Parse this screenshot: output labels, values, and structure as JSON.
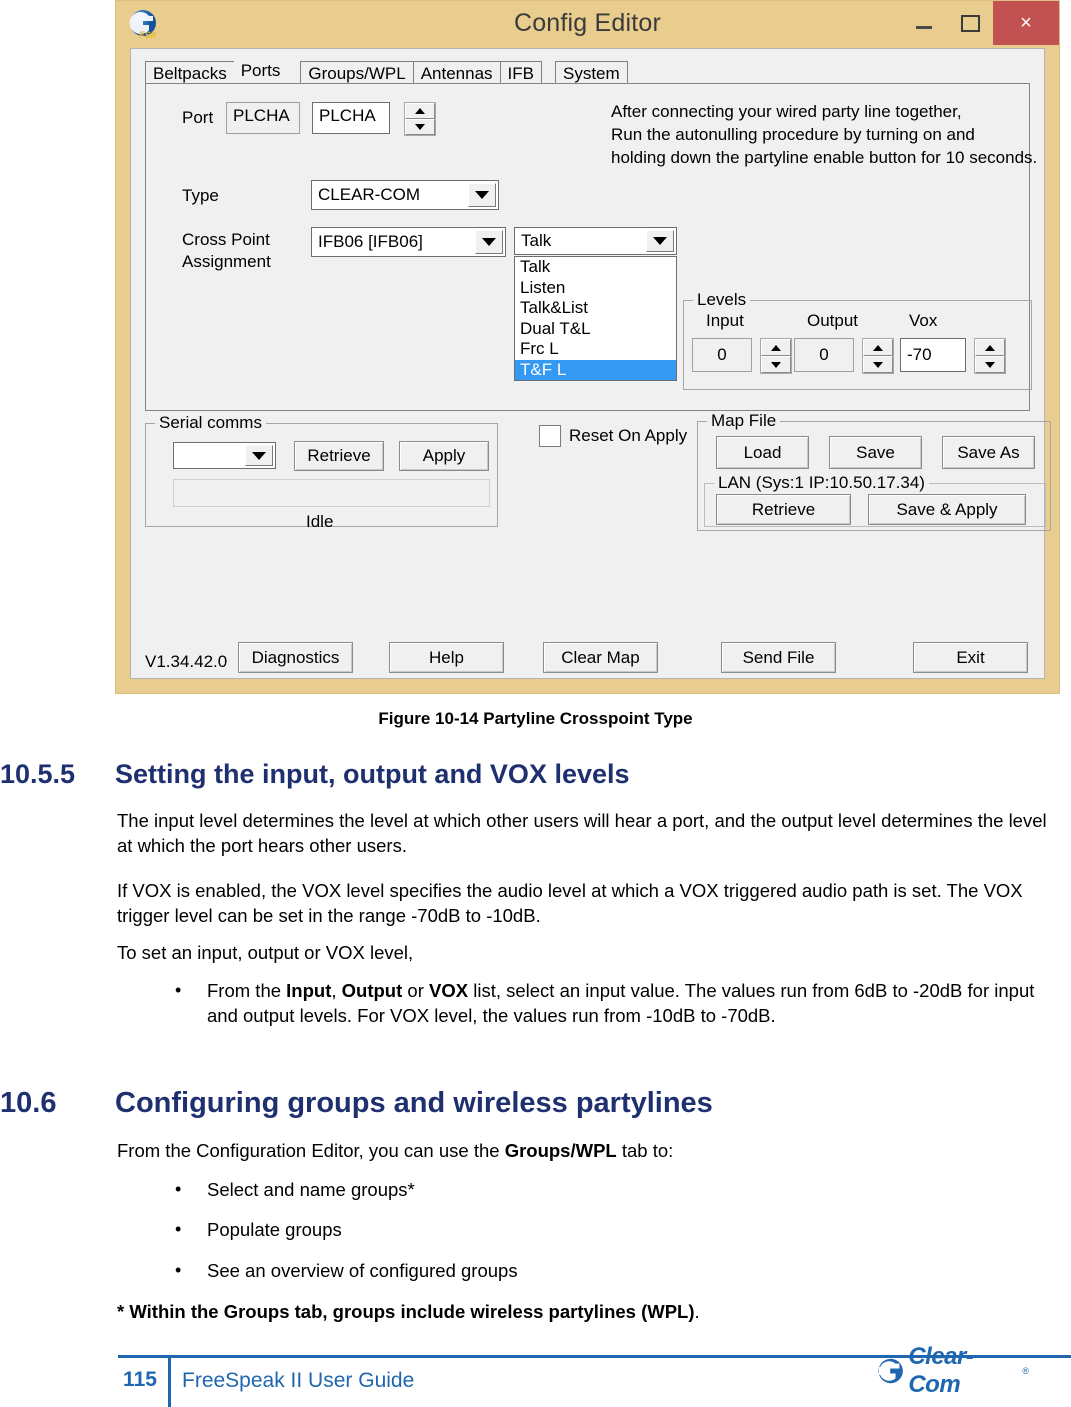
{
  "window": {
    "title": "Config Editor",
    "app_icon": "fsii-app-icon",
    "minimize": "–",
    "maximize": "□",
    "close": "×"
  },
  "tabs": [
    {
      "label": "Beltpacks",
      "active": false
    },
    {
      "label": "Ports",
      "active": true
    },
    {
      "label": "Groups/WPL",
      "active": false
    },
    {
      "label": "Antennas",
      "active": false
    },
    {
      "label": "IFB",
      "active": false
    },
    {
      "label": "System",
      "active": false
    }
  ],
  "ports_panel": {
    "port_label": "Port",
    "port_readonly_value": "PLCHA",
    "port_edit_value": "PLCHA",
    "type_label": "Type",
    "type_value": "CLEAR-COM",
    "crosspoint_label_line1": "Cross Point",
    "crosspoint_label_line2": "Assignment",
    "crosspoint_value": "IFB06  [IFB06]",
    "mode_value": "Talk",
    "mode_options": [
      "Talk",
      "Listen",
      "Talk&List",
      "Dual T&L",
      "Frc L",
      "T&F L"
    ],
    "mode_selected": "T&F L",
    "note_line1": "After connecting your wired party line together,",
    "note_line2": "Run the autonulling procedure by turning on and",
    "note_line3": "holding down the partyline enable button for 10 seconds."
  },
  "levels": {
    "group_title": "Levels",
    "input_label": "Input",
    "input_value": "0",
    "output_label": "Output",
    "output_value": "0",
    "vox_label": "Vox",
    "vox_value": "-70"
  },
  "serial_comms": {
    "group_title": "Serial comms",
    "port_select_value": "",
    "retrieve_label": "Retrieve",
    "apply_label": "Apply",
    "progress_value": "",
    "status_text": "Idle"
  },
  "reset_on_apply": {
    "label": "Reset On Apply",
    "checked": false
  },
  "map_file": {
    "group_title": "Map File",
    "load_label": "Load",
    "save_label": "Save",
    "save_as_label": "Save As",
    "lan_title": "LAN  (Sys:1 IP:10.50.17.34)",
    "lan_retrieve_label": "Retrieve",
    "lan_save_apply_label": "Save & Apply"
  },
  "bottom_bar": {
    "version": "V1.34.42.0",
    "diagnostics_label": "Diagnostics",
    "help_label": "Help",
    "clear_map_label": "Clear Map",
    "send_file_label": "Send File",
    "exit_label": "Exit"
  },
  "document": {
    "figure_caption": "Figure 10-14 Partyline Crosspoint Type",
    "section_1": {
      "number": "10.5.5",
      "title": "Setting the input, output and VOX levels",
      "para1": "The input level determines the level at which other users will hear a port, and the output level determines the level at which the port hears other users.",
      "para2": "If VOX is enabled, the VOX level specifies the audio level at which a VOX triggered audio path is set. The VOX trigger level can be set in the range -70dB to -10dB.",
      "para3": "To set an input, output or VOX level,",
      "bullet1_pre": "From the ",
      "bullet1_b1": "Input",
      "bullet1_mid1": ", ",
      "bullet1_b2": "Output",
      "bullet1_mid2": " or ",
      "bullet1_b3": "VOX",
      "bullet1_post": " list, select an input value. The values run from 6dB to -20dB for input and output levels. For VOX level, the values run from -10dB to -70dB."
    },
    "section_2": {
      "number": "10.6",
      "title": "Configuring groups and wireless partylines",
      "intro_pre": "From the Configuration Editor, you can use the ",
      "intro_bold": "Groups/WPL",
      "intro_post": " tab to:",
      "bullets": [
        "Select and name groups*",
        "Populate groups",
        "See an overview of configured groups"
      ],
      "footnote_bold": "* Within the Groups tab, groups include wireless partylines (WPL)",
      "footnote_tail": "."
    }
  },
  "footer": {
    "page_number": "115",
    "guide_title": "FreeSpeak II User Guide",
    "logo_text": "Clear-Com",
    "logo_tm": "®"
  },
  "colors": {
    "title_bar": "#e8cd8f",
    "close_button": "#c25252",
    "heading_blue": "#1f3070",
    "footer_blue": "#1f66b0",
    "selection_blue": "#3399f3",
    "dialog_face": "#f0f0f0"
  }
}
